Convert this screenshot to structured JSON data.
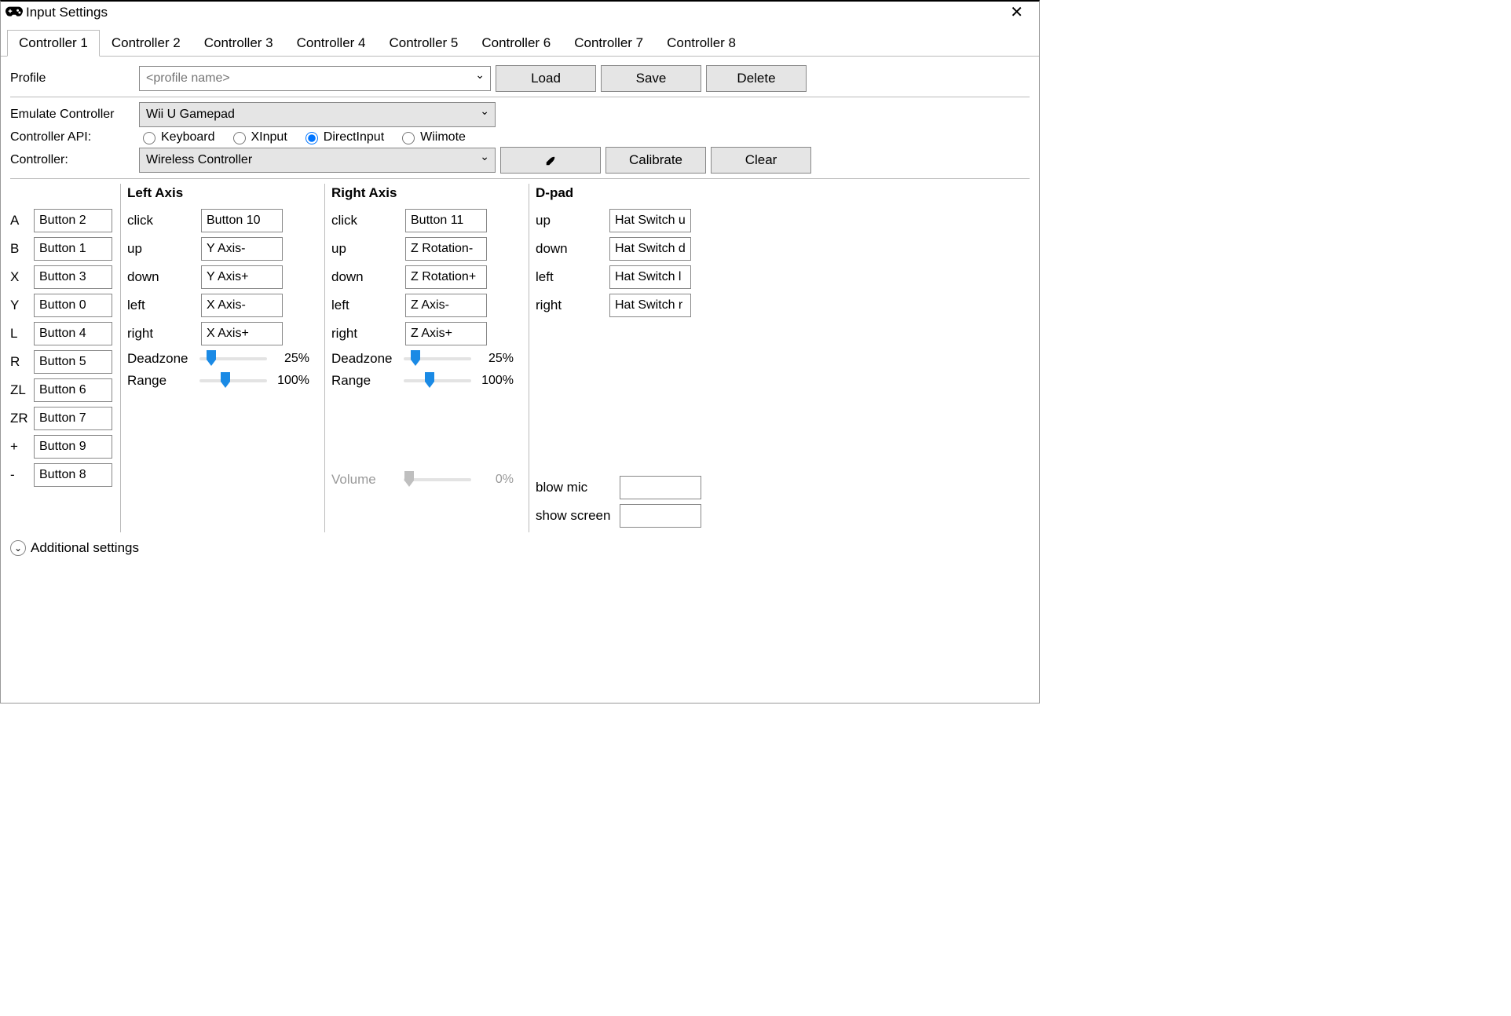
{
  "window": {
    "title": "Input Settings"
  },
  "tabs": [
    "Controller 1",
    "Controller 2",
    "Controller 3",
    "Controller 4",
    "Controller 5",
    "Controller 6",
    "Controller 7",
    "Controller 8"
  ],
  "active_tab": 0,
  "labels": {
    "profile": "Profile",
    "emulate": "Emulate Controller",
    "api": "Controller API:",
    "controller": "Controller:",
    "additional": "Additional settings"
  },
  "profile": {
    "placeholder": "<profile name>",
    "buttons": {
      "load": "Load",
      "save": "Save",
      "delete": "Delete"
    }
  },
  "emulate": {
    "value": "Wii U Gamepad"
  },
  "api": {
    "options": [
      "Keyboard",
      "XInput",
      "DirectInput",
      "Wiimote"
    ],
    "selected": "DirectInput"
  },
  "controller": {
    "value": "Wireless Controller",
    "buttons": {
      "calibrate": "Calibrate",
      "clear": "Clear"
    }
  },
  "sections": {
    "buttons": {
      "rows": [
        {
          "label": "A",
          "value": "Button 2"
        },
        {
          "label": "B",
          "value": "Button 1"
        },
        {
          "label": "X",
          "value": "Button 3"
        },
        {
          "label": "Y",
          "value": "Button 0"
        },
        {
          "label": "L",
          "value": "Button 4"
        },
        {
          "label": "R",
          "value": "Button 5"
        },
        {
          "label": "ZL",
          "value": "Button 6"
        },
        {
          "label": "ZR",
          "value": "Button 7"
        },
        {
          "label": "+",
          "value": "Button 9"
        },
        {
          "label": "-",
          "value": "Button 8"
        }
      ]
    },
    "left_axis": {
      "title": "Left Axis",
      "rows": [
        {
          "label": "click",
          "value": "Button 10"
        },
        {
          "label": "up",
          "value": "Y Axis-"
        },
        {
          "label": "down",
          "value": "Y Axis+"
        },
        {
          "label": "left",
          "value": "X Axis-"
        },
        {
          "label": "right",
          "value": "X Axis+"
        }
      ],
      "deadzone": {
        "label": "Deadzone",
        "percent": 25
      },
      "range": {
        "label": "Range",
        "percent": 100
      }
    },
    "right_axis": {
      "title": "Right Axis",
      "rows": [
        {
          "label": "click",
          "value": "Button 11"
        },
        {
          "label": "up",
          "value": "Z Rotation-"
        },
        {
          "label": "down",
          "value": "Z Rotation+"
        },
        {
          "label": "left",
          "value": "Z Axis-"
        },
        {
          "label": "right",
          "value": "Z Axis+"
        }
      ],
      "deadzone": {
        "label": "Deadzone",
        "percent": 25
      },
      "range": {
        "label": "Range",
        "percent": 100
      },
      "volume": {
        "label": "Volume",
        "percent": 0
      }
    },
    "dpad": {
      "title": "D-pad",
      "rows": [
        {
          "label": "up",
          "value": "Hat Switch u"
        },
        {
          "label": "down",
          "value": "Hat Switch d"
        },
        {
          "label": "left",
          "value": "Hat Switch l"
        },
        {
          "label": "right",
          "value": "Hat Switch r"
        }
      ],
      "extra": [
        {
          "label": "blow mic",
          "value": ""
        },
        {
          "label": "show screen",
          "value": ""
        }
      ]
    }
  }
}
